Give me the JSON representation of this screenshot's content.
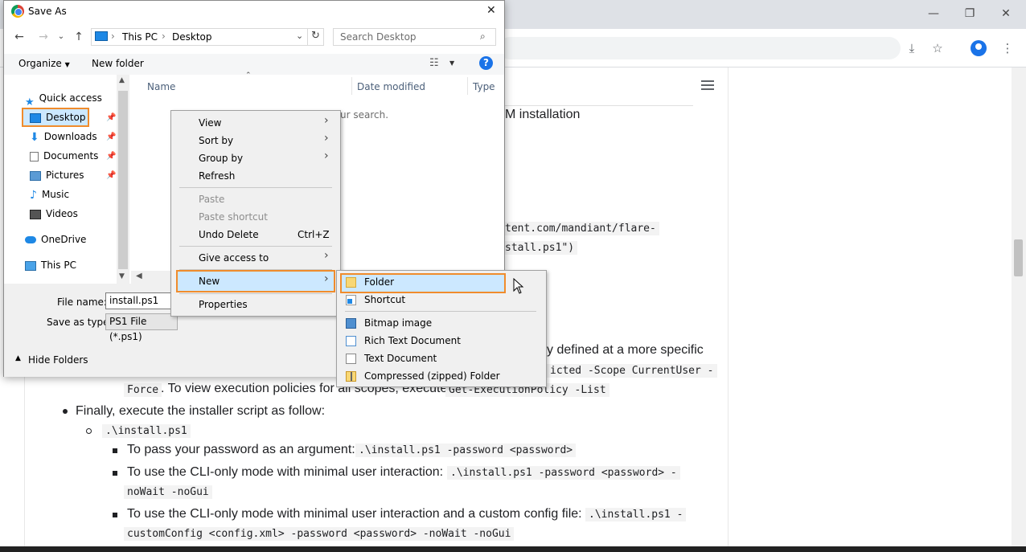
{
  "dialog": {
    "title": "Save As",
    "close_glyph": "✕",
    "breadcrumb": [
      "This PC",
      "Desktop"
    ],
    "breadcrumb_sep": "›",
    "search_placeholder": "Search Desktop",
    "organize_label": "Organize",
    "new_folder_label": "New folder",
    "help_glyph": "?",
    "nav": {
      "quick_access": "Quick access",
      "items": [
        "Desktop",
        "Downloads",
        "Documents",
        "Pictures",
        "Music",
        "Videos"
      ],
      "onedrive": "OneDrive",
      "thispc": "This PC"
    },
    "columns": {
      "name": "Name",
      "date": "Date modified",
      "type": "Type"
    },
    "empty_text": "ur search.",
    "file_name_label": "File name:",
    "file_name_value": "install.ps1",
    "save_type_label": "Save as type:",
    "save_type_value": "PS1 File (*.ps1)",
    "hide_folders": "Hide Folders"
  },
  "context_menu": {
    "view": "View",
    "sort_by": "Sort by",
    "group_by": "Group by",
    "refresh": "Refresh",
    "paste": "Paste",
    "paste_shortcut": "Paste shortcut",
    "undo_delete": "Undo Delete",
    "undo_shortcut": "Ctrl+Z",
    "give_access": "Give access to",
    "new": "New",
    "properties": "Properties"
  },
  "new_submenu": {
    "folder": "Folder",
    "shortcut": "Shortcut",
    "bitmap": "Bitmap image",
    "rtf": "Rich Text Document",
    "text": "Text Document",
    "zip": "Compressed (zipped) Folder"
  },
  "browser": {
    "minimize": "—",
    "restore": "❐",
    "close": "✕",
    "download_glyph": "⤓",
    "star_glyph": "☆",
    "menu_glyph": "⋮"
  },
  "page": {
    "heading_fragment": "M installation",
    "code_line1": "tent.com/mandiant/flare-",
    "code_line2": "stall.ps1\")",
    "policy_fragment": "y defined at a more specific",
    "policy_code": "icted -Scope CurrentUser -",
    "force_code": "Force",
    "view_policies": ". To view execution policies for all scopes, execute",
    "list_code": "Get-ExecutionPolicy -List",
    "finally": "Finally, execute the installer script as follow:",
    "install_code": ".\\install.ps1",
    "pass_pw": "To pass your password as an argument:",
    "pass_pw_code": ".\\install.ps1 -password <password>",
    "cli_only": "To use the CLI-only mode with minimal user interaction:",
    "cli_only_code1": ".\\install.ps1 -password <password> -",
    "cli_only_code2": "noWait -noGui",
    "cli_config": "To use the CLI-only mode with minimal user interaction and a custom config file:",
    "cli_config_code1": ".\\install.ps1 -",
    "cli_config_code2": "customConfig <config.xml> -password <password> -noWait -noGui"
  }
}
